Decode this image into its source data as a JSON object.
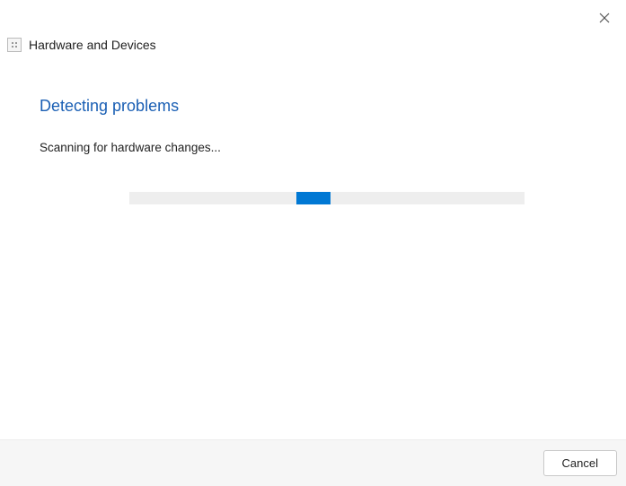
{
  "window": {
    "close_label": "Close"
  },
  "header": {
    "title": "Hardware and Devices",
    "icon": "troubleshooter-icon"
  },
  "main": {
    "heading": "Detecting problems",
    "status": "Scanning for hardware changes...",
    "progress": {
      "mode": "indeterminate"
    }
  },
  "footer": {
    "cancel_label": "Cancel"
  },
  "colors": {
    "heading": "#1a5fb4",
    "progress_fill": "#0078d4",
    "progress_track": "#eeeeee",
    "footer_bg": "#f6f6f6"
  }
}
